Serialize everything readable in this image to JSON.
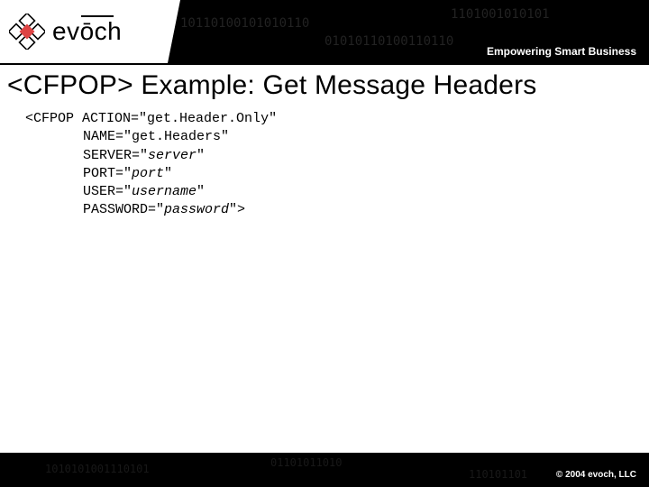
{
  "header": {
    "logo_text": "evōch",
    "tagline": "Empowering Smart Business"
  },
  "title": "<CFPOP> Example: Get Message Headers",
  "code": {
    "line1_tag": "<CFPOP",
    "line1_attr": "ACTION=\"get.Header.Only\"",
    "line2_key": "NAME=\"",
    "line2_val": "get.Headers",
    "line2_end": "\"",
    "line3_key": "SERVER=\"",
    "line3_val": "server",
    "line3_end": "\"",
    "line4_key": "PORT=\"",
    "line4_val": "port",
    "line4_end": "\"",
    "line5_key": "USER=\"",
    "line5_val": "username",
    "line5_end": "\"",
    "line6_key": "PASSWORD=\"",
    "line6_val": "password",
    "line6_end": "\">"
  },
  "footer": {
    "copyright": "© 2004 evoch, LLC"
  }
}
